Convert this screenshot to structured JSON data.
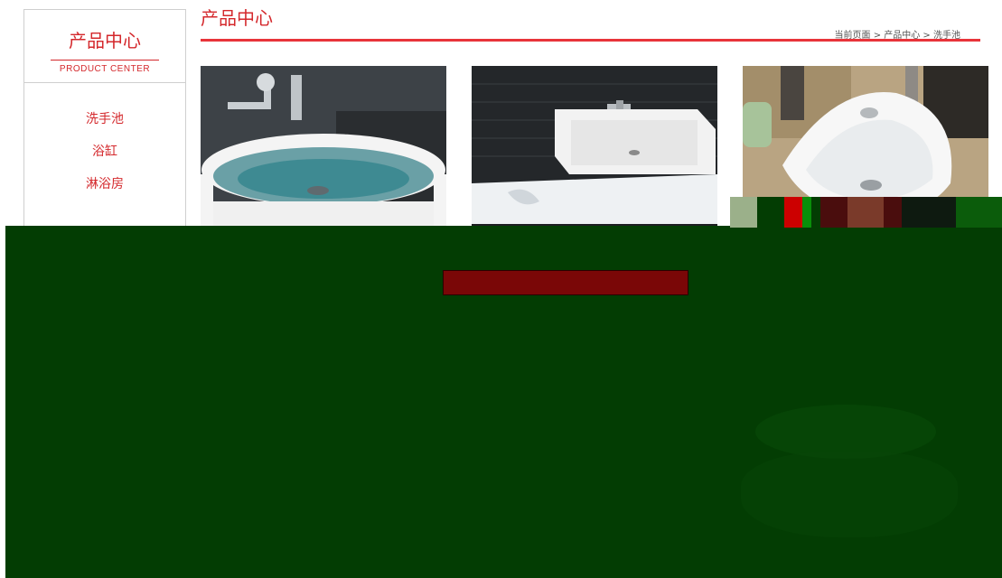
{
  "sidebar": {
    "title": "产品中心",
    "subtitle": "PRODUCT CENTER",
    "items": [
      {
        "label": "洗手池"
      },
      {
        "label": "浴缸"
      },
      {
        "label": "淋浴房"
      }
    ]
  },
  "header": {
    "title": "产品中心",
    "breadcrumb": "当前页面 > 产品中心 > 洗手池"
  },
  "products": [
    {
      "image": "round-vessel-sink-photo"
    },
    {
      "image": "rectangular-sink-photo"
    },
    {
      "image": "corner-sink-photo"
    }
  ],
  "colors": {
    "accent": "#d4282c",
    "header_line": "#e8343a",
    "overlay": "#033d03",
    "button": "#7a0707"
  }
}
